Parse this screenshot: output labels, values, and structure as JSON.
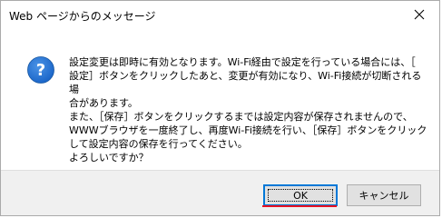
{
  "dialog": {
    "title": "Web ページからのメッセージ",
    "icon": "question-icon",
    "message_lines": [
      "設定変更は即時に有効となります。Wi-Fi経由で設定を行っている場合には、［",
      "設定］ボタンをクリックしたあと、変更が有効になり、Wi-Fi接続が切断される場",
      "合があります。",
      "また、［保存］ボタンをクリックするまでは設定内容が保存されませんので、",
      "WWWブラウザを一度終了し、再度Wi-Fi接続を行い、［保存］ボタンをクリック",
      "して設定内容の保存を行ってください。",
      "よろしいですか？"
    ],
    "ok_label": "OK",
    "cancel_label": "キャンセル",
    "close_icon": "close-icon"
  },
  "colors": {
    "icon_blue": "#1b66c9",
    "focus_border": "#0078d7",
    "annotation_red": "#e81123"
  }
}
